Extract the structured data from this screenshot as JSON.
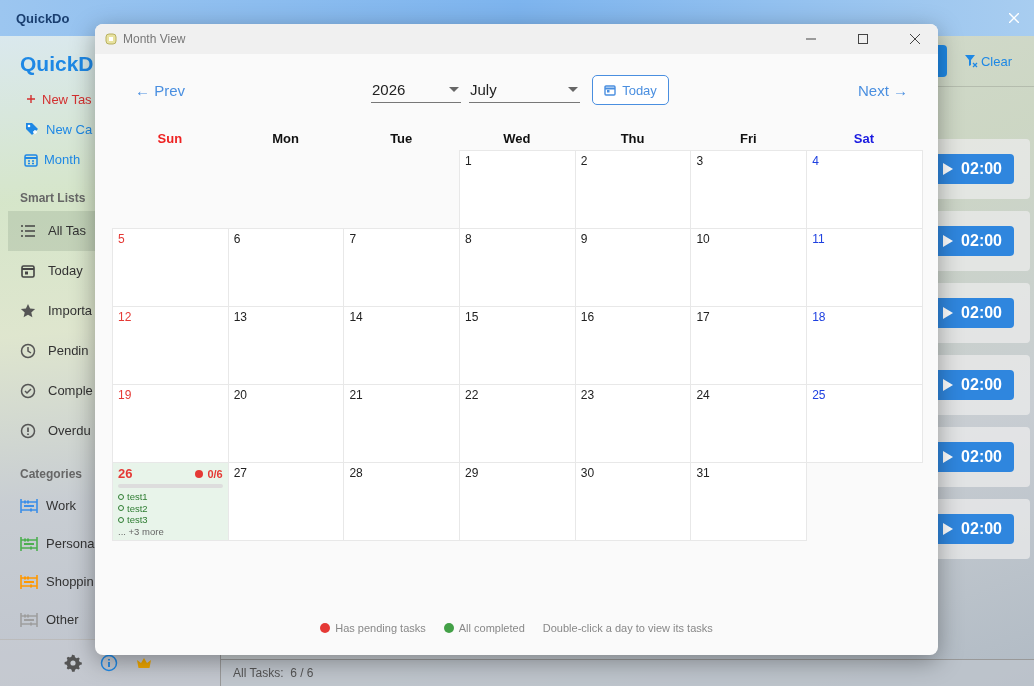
{
  "window": {
    "title": "QuickDo"
  },
  "sidebar": {
    "logo": "QuickD",
    "actions": [
      {
        "label": "New Tas",
        "kind": "add"
      },
      {
        "label": "New Ca",
        "kind": "category"
      },
      {
        "label": "Month",
        "kind": "month"
      }
    ],
    "sections": [
      {
        "title": "Smart Lists",
        "items": [
          {
            "label": "All Tas",
            "selected": true
          },
          {
            "label": "Today",
            "selected": false
          },
          {
            "label": "Importa",
            "selected": false
          },
          {
            "label": "Pendin",
            "selected": false
          },
          {
            "label": "Comple",
            "selected": false
          },
          {
            "label": "Overdu",
            "selected": false
          }
        ]
      },
      {
        "title": "Categories",
        "items": [
          {
            "label": "Work",
            "selected": false,
            "color": "#3b8ee8"
          },
          {
            "label": "Persona",
            "selected": false,
            "color": "#4caf50"
          },
          {
            "label": "Shoppin",
            "selected": false,
            "color": "#ff9800"
          },
          {
            "label": "Other",
            "selected": false,
            "color": "#9e9e9e"
          }
        ]
      }
    ]
  },
  "toolbar": {
    "clear": "Clear"
  },
  "tasks": [
    {
      "timer": "02:00"
    },
    {
      "timer": "02:00"
    },
    {
      "timer": "02:00"
    },
    {
      "timer": "02:00"
    },
    {
      "timer": "02:00"
    },
    {
      "timer": "02:00"
    }
  ],
  "status_bar": "All Tasks:  6 / 6",
  "dialog": {
    "title": "Month View",
    "prev": "← Prev",
    "next": "Next →",
    "year": "2026",
    "month": "July",
    "today_button": "Today",
    "weekdays": [
      "Sun",
      "Mon",
      "Tue",
      "Wed",
      "Thu",
      "Fri",
      "Sat"
    ],
    "weeks": [
      [
        {
          "kind": "blank"
        },
        {
          "kind": "blank"
        },
        {
          "kind": "blank"
        },
        {
          "day": "1"
        },
        {
          "day": "2"
        },
        {
          "day": "3"
        },
        {
          "day": "4"
        }
      ],
      [
        {
          "day": "5"
        },
        {
          "day": "6"
        },
        {
          "day": "7"
        },
        {
          "day": "8"
        },
        {
          "day": "9"
        },
        {
          "day": "10"
        },
        {
          "day": "11"
        }
      ],
      [
        {
          "day": "12"
        },
        {
          "day": "13"
        },
        {
          "day": "14"
        },
        {
          "day": "15"
        },
        {
          "day": "16"
        },
        {
          "day": "17"
        },
        {
          "day": "18"
        }
      ],
      [
        {
          "day": "19"
        },
        {
          "day": "20"
        },
        {
          "day": "21"
        },
        {
          "day": "22"
        },
        {
          "day": "23"
        },
        {
          "day": "24"
        },
        {
          "day": "25"
        }
      ],
      [
        {
          "day": "26",
          "today": true,
          "color": "#e53935",
          "count": "0/6",
          "level": 0,
          "tasks": [
            "test1",
            "test2",
            "test3"
          ],
          "more": "... +3 more"
        },
        {
          "day": "27"
        },
        {
          "day": "28"
        },
        {
          "day": "29"
        },
        {
          "day": "30"
        },
        {
          "day": "31"
        },
        {
          "kind": "blank"
        }
      ]
    ],
    "legend": [
      {
        "label": "Has pending tasks",
        "color": "#e53935"
      },
      {
        "label": "All completed",
        "color": "#43a047"
      }
    ],
    "hint": "Double-click a day to view its tasks"
  }
}
